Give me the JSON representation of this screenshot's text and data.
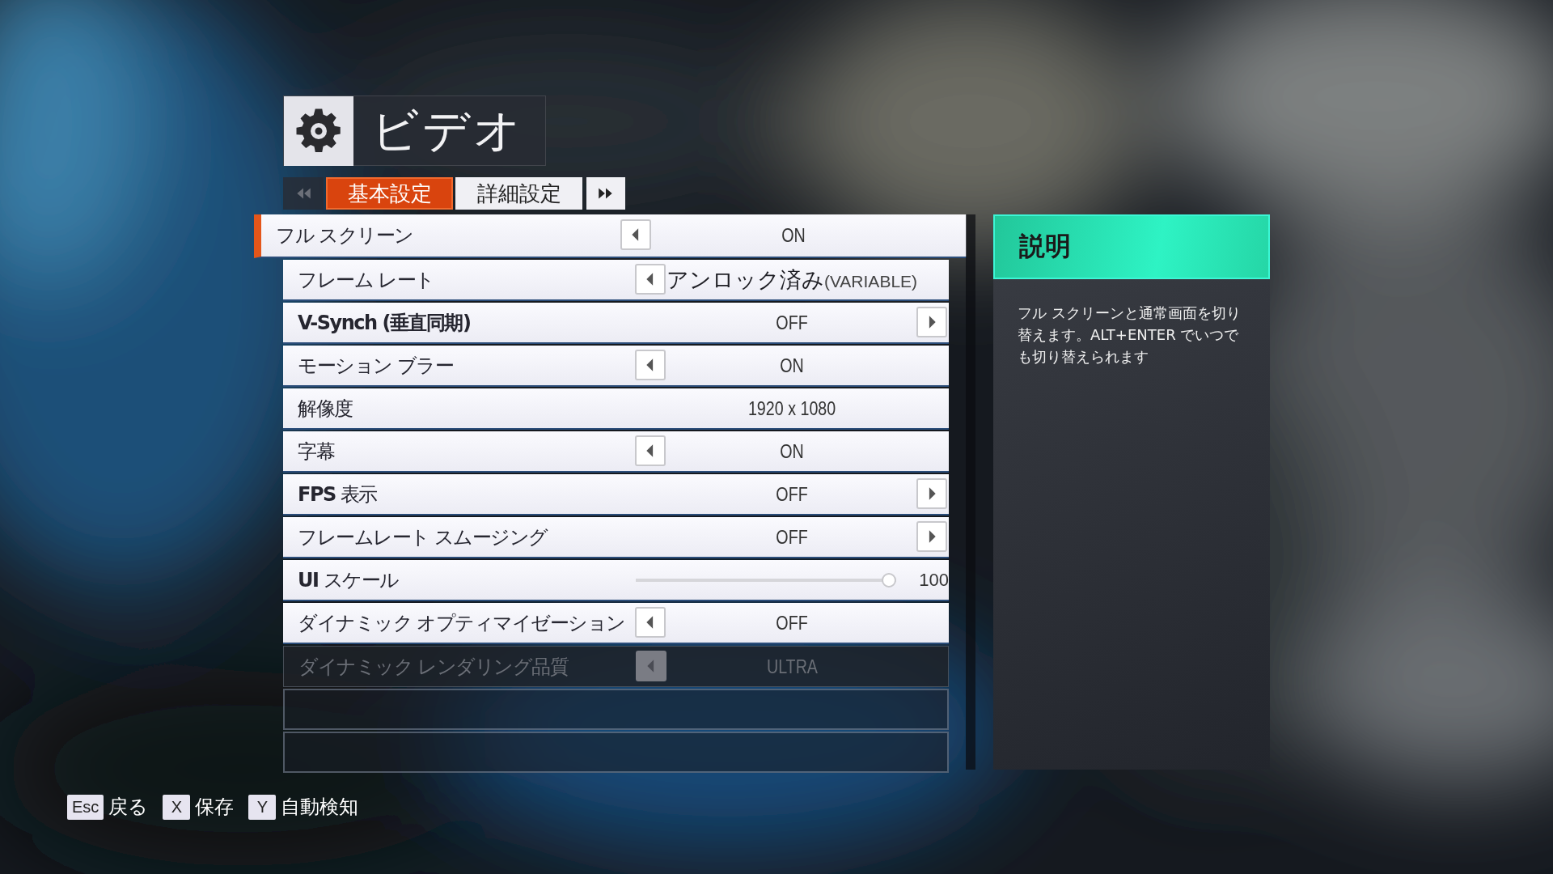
{
  "header": {
    "title": "ビデオ"
  },
  "tabs": [
    {
      "label": "基本設定",
      "selected": true
    },
    {
      "label": "詳細設定",
      "selected": false
    }
  ],
  "settings": [
    {
      "kind": "choice",
      "label": "フル スクリーン",
      "value": "ON",
      "left": true,
      "right": false,
      "selected": true,
      "disabled": false
    },
    {
      "kind": "choice",
      "label": "フレーム レート",
      "value": "アンロック済み",
      "suffix": "(VARIABLE)",
      "left": true,
      "right": false,
      "selected": false,
      "disabled": false
    },
    {
      "kind": "choice",
      "label": "**V-Synch (垂直同期)**",
      "value": "OFF",
      "left": false,
      "right": true,
      "selected": false,
      "disabled": false
    },
    {
      "kind": "choice",
      "label": "モーション ブラー",
      "value": "ON",
      "left": true,
      "right": false,
      "selected": false,
      "disabled": false
    },
    {
      "kind": "choice",
      "label": "解像度",
      "value": "1920 x 1080",
      "left": false,
      "right": false,
      "selected": false,
      "disabled": false
    },
    {
      "kind": "choice",
      "label": "字幕",
      "value": "ON",
      "left": true,
      "right": false,
      "selected": false,
      "disabled": false
    },
    {
      "kind": "choice",
      "label": "**FPS** 表示",
      "value": "OFF",
      "left": false,
      "right": true,
      "selected": false,
      "disabled": false
    },
    {
      "kind": "choice",
      "label": "フレームレート スムージング",
      "value": "OFF",
      "left": false,
      "right": true,
      "selected": false,
      "disabled": false
    },
    {
      "kind": "slider",
      "label": "**UI** スケール",
      "value": "100",
      "level": 1,
      "selected": false,
      "disabled": false
    },
    {
      "kind": "choice",
      "label": "ダイナミック オプティマイゼーション",
      "value": "OFF",
      "left": true,
      "right": false,
      "selected": false,
      "disabled": false
    },
    {
      "kind": "choice",
      "label": "ダイナミック レンダリング品質",
      "value": "ULTRA",
      "left": true,
      "right": false,
      "selected": false,
      "disabled": true
    },
    {
      "kind": "empty"
    },
    {
      "kind": "empty"
    }
  ],
  "description": {
    "title": "説明",
    "text": "フル スクリーンと通常画面を切り替えます。ALT+ENTER でいつでも切り替えられます"
  },
  "footer": [
    {
      "key": "Esc",
      "label": "戻る"
    },
    {
      "key": "X",
      "label": "保存"
    },
    {
      "key": "Y",
      "label": "自動検知"
    }
  ]
}
